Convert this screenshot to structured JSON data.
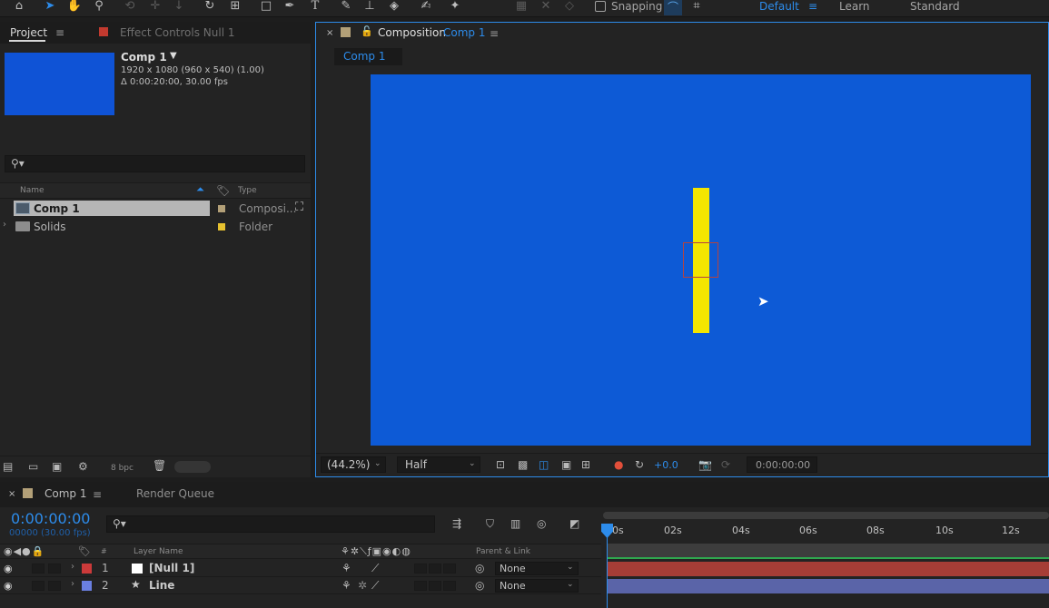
{
  "toolbar": {
    "snapping_label": "Snapping",
    "workspaces": [
      "Default",
      "Learn",
      "Standard"
    ],
    "colors": {
      "active": "#2d8ceb"
    }
  },
  "project_panel": {
    "tab_label": "Project",
    "effect_controls_label": "Effect Controls Null 1",
    "preview": {
      "name": "Comp 1",
      "dims": "1920 x 1080  (960 x 540) (1.00)",
      "duration": "Δ 0:00:20:00, 30.00 fps",
      "thumb_color": "#0f53d6"
    },
    "columns": {
      "name": "Name",
      "type": "Type"
    },
    "items": [
      {
        "name": "Comp 1",
        "type": "Composi...",
        "label_color": "#b3a078"
      },
      {
        "name": "Solids",
        "type": "Folder",
        "label_color": "#e6c12f"
      }
    ],
    "bpc_label": "8 bpc"
  },
  "comp_panel": {
    "tab_prefix": "Composition",
    "tab_comp": "Comp 1",
    "subtab": "Comp 1",
    "bg_color": "#0d5ad6",
    "zoom": "(44.2%)",
    "resolution": "Half",
    "exposure": "+0.0",
    "timecode": "0:00:00:00"
  },
  "timeline": {
    "tab_label": "Comp 1",
    "render_queue_label": "Render Queue",
    "timecode": "0:00:00:00",
    "frame_info": "00000 (30.00 fps)",
    "header": {
      "layer_name": "Layer Name",
      "parent_link": "Parent & Link"
    },
    "ruler": [
      "0s",
      "02s",
      "04s",
      "06s",
      "08s",
      "10s",
      "12s"
    ],
    "layers": [
      {
        "num": "1",
        "name": "[Null 1]",
        "parent": "None",
        "label_color": "#cc3a3a",
        "bar_color": "#a63d36"
      },
      {
        "num": "2",
        "name": "Line",
        "parent": "None",
        "label_color": "#6a7fe0",
        "bar_color": "#5a64a8"
      }
    ]
  }
}
